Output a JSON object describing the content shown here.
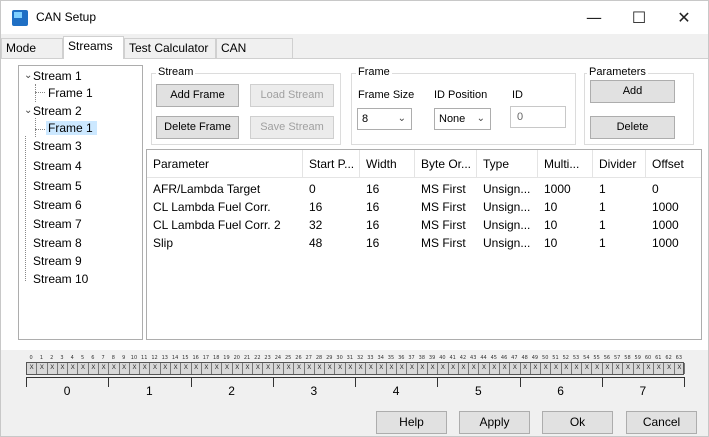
{
  "window": {
    "title": "CAN Setup",
    "minimize": "—",
    "maximize": "☐",
    "close": "✕"
  },
  "tabs": [
    {
      "label": "Mode"
    },
    {
      "label": "Streams"
    },
    {
      "label": "Test Calculator"
    },
    {
      "label": "CAN Devices"
    }
  ],
  "tree": {
    "items": [
      {
        "label": "Stream 1"
      },
      {
        "label": "Frame 1"
      },
      {
        "label": "Stream 2"
      },
      {
        "label": "Frame 1"
      },
      {
        "label": "Stream 3"
      },
      {
        "label": "Stream 4"
      },
      {
        "label": "Stream 5"
      },
      {
        "label": "Stream 6"
      },
      {
        "label": "Stream 7"
      },
      {
        "label": "Stream 8"
      },
      {
        "label": "Stream 9"
      },
      {
        "label": "Stream 10"
      }
    ]
  },
  "stream_group": {
    "title": "Stream",
    "add_frame": "Add Frame",
    "load_stream": "Load Stream",
    "delete_frame": "Delete Frame",
    "save_stream": "Save Stream"
  },
  "frame_group": {
    "title": "Frame",
    "frame_size_label": "Frame Size",
    "frame_size_value": "8",
    "id_position_label": "ID Position",
    "id_position_value": "None",
    "id_label": "ID",
    "id_placeholder": "0"
  },
  "parameters_group": {
    "title": "Parameters",
    "add": "Add",
    "delete": "Delete"
  },
  "table": {
    "columns": [
      "Parameter",
      "Start P...",
      "Width",
      "Byte Or...",
      "Type",
      "Multi...",
      "Divider",
      "Offset"
    ],
    "rows": [
      [
        "AFR/Lambda Target",
        "0",
        "16",
        "MS First",
        "Unsign...",
        "1000",
        "1",
        "0"
      ],
      [
        "CL Lambda  Fuel  Corr.",
        "16",
        "16",
        "MS First",
        "Unsign...",
        "10",
        "1",
        "1000"
      ],
      [
        "CL Lambda  Fuel  Corr. 2",
        "32",
        "16",
        "MS First",
        "Unsign...",
        "10",
        "1",
        "1000"
      ],
      [
        "Slip",
        "48",
        "16",
        "MS First",
        "Unsign...",
        "10",
        "1",
        "1000"
      ]
    ]
  },
  "bit_numbers": [
    "0",
    "1",
    "2",
    "3",
    "4",
    "5",
    "6",
    "7",
    "8",
    "9",
    "10",
    "11",
    "12",
    "13",
    "14",
    "15",
    "16",
    "17",
    "18",
    "19",
    "20",
    "21",
    "22",
    "23",
    "24",
    "25",
    "26",
    "27",
    "28",
    "29",
    "30",
    "31",
    "32",
    "33",
    "34",
    "35",
    "36",
    "37",
    "38",
    "39",
    "40",
    "41",
    "42",
    "43",
    "44",
    "45",
    "46",
    "47",
    "48",
    "49",
    "50",
    "51",
    "52",
    "53",
    "54",
    "55",
    "56",
    "57",
    "58",
    "59",
    "60",
    "61",
    "62",
    "63"
  ],
  "bit_mark": "X",
  "byte_numbers": [
    "0",
    "1",
    "2",
    "3",
    "4",
    "5",
    "6",
    "7"
  ],
  "footer": {
    "help": "Help",
    "apply": "Apply",
    "ok": "Ok",
    "cancel": "Cancel"
  }
}
